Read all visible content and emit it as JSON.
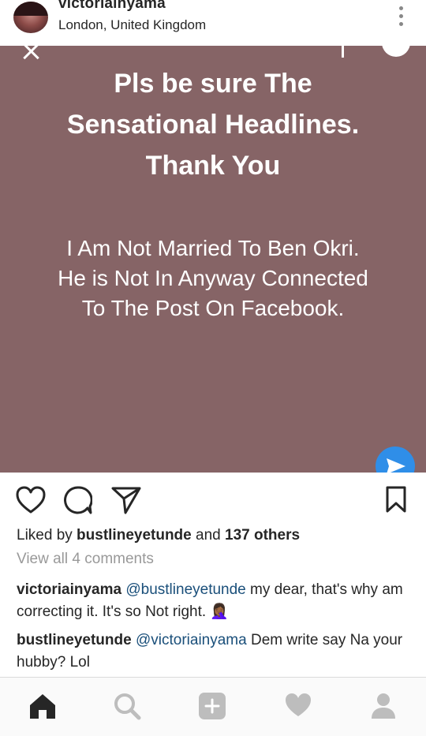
{
  "header": {
    "username": "victoriainyama",
    "location": "London, United Kingdom"
  },
  "post": {
    "headline_lines": [
      "Pls be sure The",
      "Sensational Headlines.",
      "Thank You"
    ],
    "subtext_lines": [
      "I Am Not Married To Ben Okri.",
      "He is Not In Anyway Connected",
      "To The Post On Facebook."
    ],
    "background_color": "#866466"
  },
  "likes": {
    "prefix": "Liked by ",
    "liker": "bustlineyetunde",
    "middle": " and ",
    "others": "137 others"
  },
  "view_all": "View all 4 comments",
  "comments": [
    {
      "user": "victoriainyama",
      "mention": "@bustlineyetunde",
      "text": " my dear, that's why am correcting it. It's so Not right. 🤦🏾‍♀"
    },
    {
      "user": "bustlineyetunde",
      "mention": "@victoriainyama",
      "text": " Dem write say Na your hubby? Lol"
    }
  ],
  "icons": {
    "header": [
      "more-vertical-icon"
    ],
    "actions": [
      "heart-icon",
      "comment-icon",
      "share-icon",
      "bookmark-icon"
    ],
    "nav": [
      "home-icon",
      "search-icon",
      "add-icon",
      "activity-heart-icon",
      "profile-icon"
    ]
  },
  "colors": {
    "mention": "#1a4f7a",
    "send_button": "#2f8ee8",
    "muted_text": "#999999"
  }
}
